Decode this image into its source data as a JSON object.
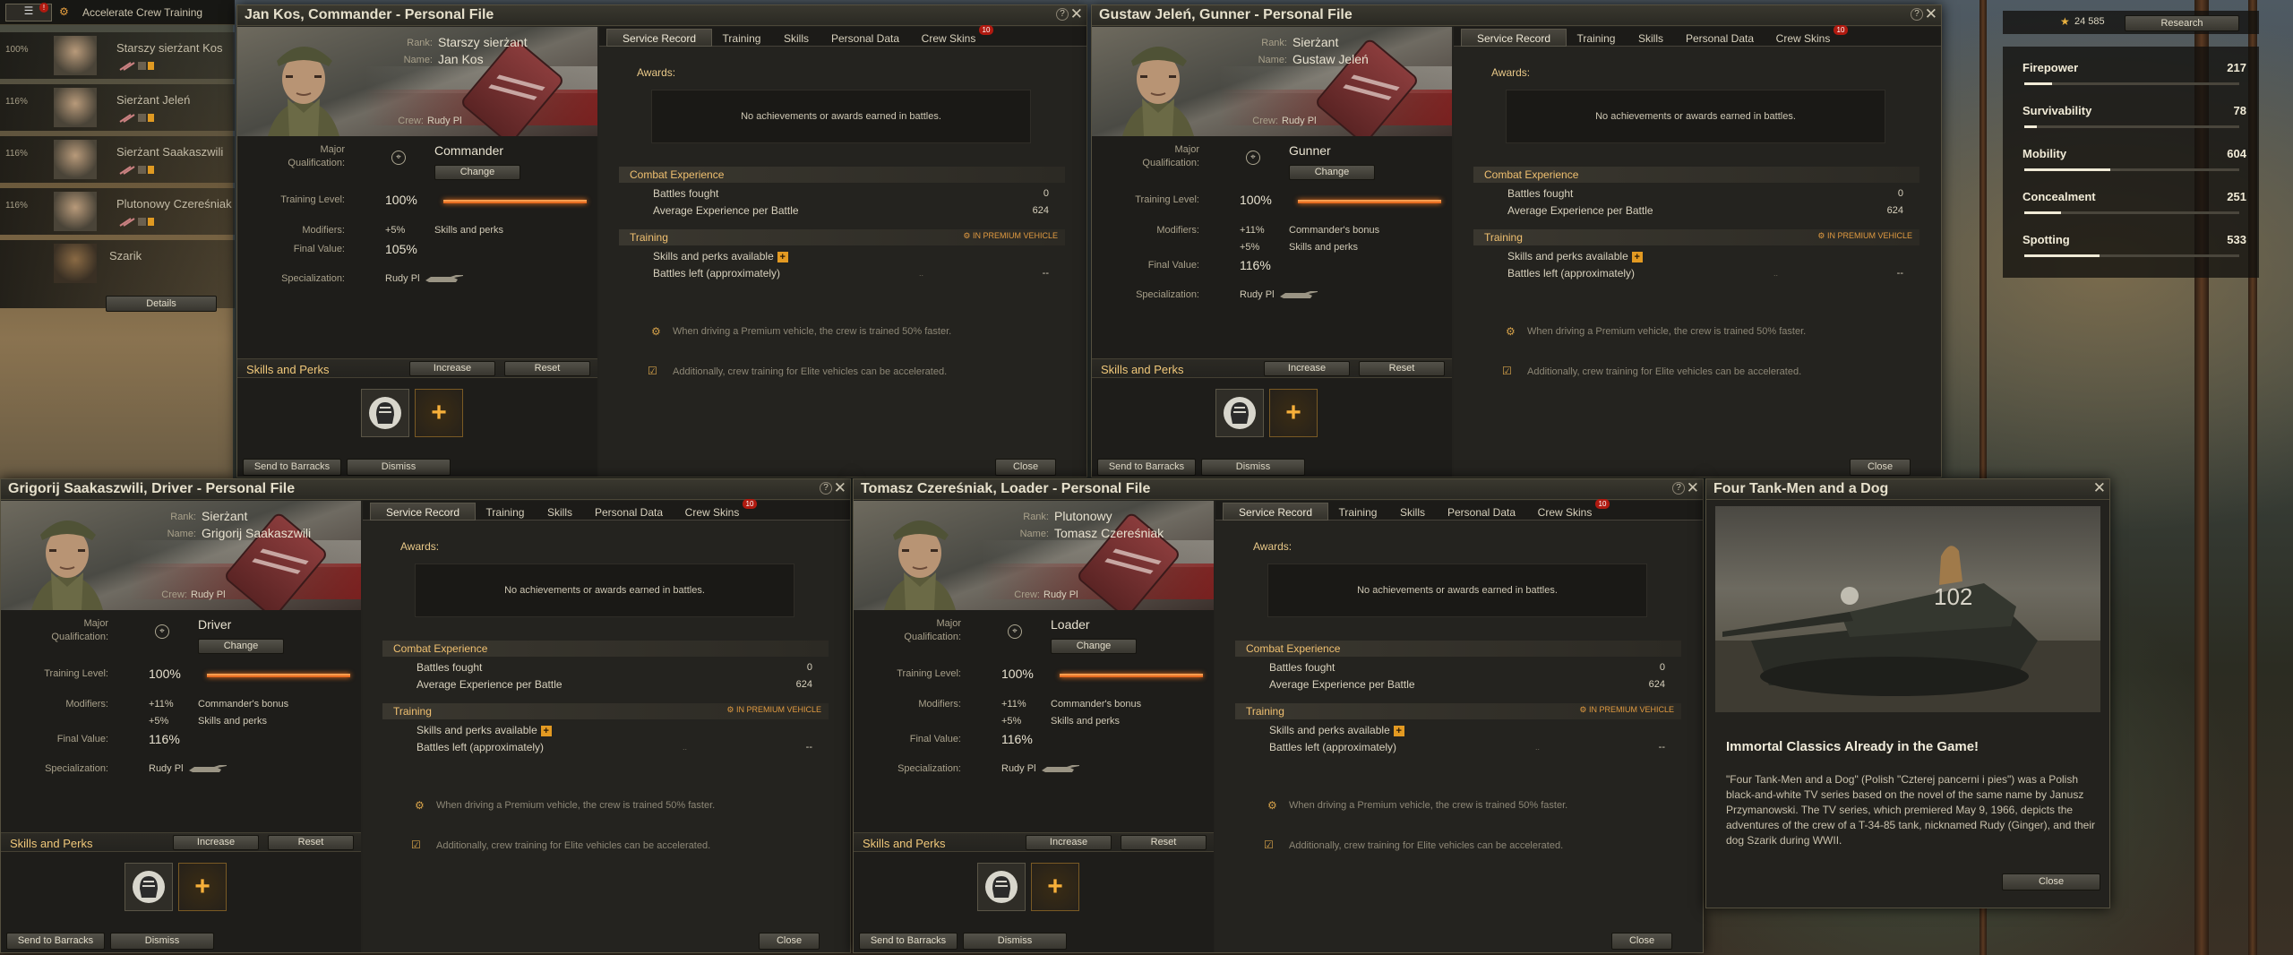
{
  "topbar": {
    "title": "Accelerate Crew Training",
    "badge": "!"
  },
  "crew_list": [
    {
      "pct": "100%",
      "name": "Starszy sierżant Kos"
    },
    {
      "pct": "116%",
      "name": "Sierżant Jeleń"
    },
    {
      "pct": "116%",
      "name": "Sierżant Saakaszwili"
    },
    {
      "pct": "116%",
      "name": "Plutonowy Czereśniak"
    },
    {
      "pct": "",
      "name": "Szarik"
    }
  ],
  "details_button": "Details",
  "resources": {
    "credits": "24 585",
    "research_button": "Research"
  },
  "stats": [
    {
      "label": "Firepower",
      "value": "217",
      "fill": 0.13
    },
    {
      "label": "Survivability",
      "value": "78",
      "fill": 0.06
    },
    {
      "label": "Mobility",
      "value": "604",
      "fill": 0.4
    },
    {
      "label": "Concealment",
      "value": "251",
      "fill": 0.17
    },
    {
      "label": "Spotting",
      "value": "533",
      "fill": 0.35
    }
  ],
  "labels": {
    "rank": "Rank:",
    "name": "Name:",
    "crew": "Crew:",
    "major_qualification_1": "Major",
    "major_qualification_2": "Qualification:",
    "change": "Change",
    "training_level": "Training Level:",
    "modifiers": "Modifiers:",
    "final_value": "Final Value:",
    "specialization": "Specialization:",
    "skills_and_perks": "Skills and Perks",
    "increase": "Increase",
    "reset": "Reset",
    "send_to_barracks": "Send to Barracks",
    "dismiss": "Dismiss",
    "close": "Close",
    "awards": "Awards:",
    "no_awards": "No achievements or awards earned in battles.",
    "combat_experience": "Combat Experience",
    "battles_fought": "Battles fought",
    "avg_exp": "Average Experience per Battle",
    "training": "Training",
    "in_premium": "IN PREMIUM VEHICLE",
    "skills_available": "Skills and perks available",
    "battles_left": "Battles left (approximately)",
    "note_premium": "When driving a Premium vehicle, the crew is trained 50% faster.",
    "note_elite": "Additionally, crew training for Elite vehicles can be accelerated."
  },
  "tabs": [
    "Service Record",
    "Training",
    "Skills",
    "Personal Data",
    "Crew Skins"
  ],
  "tab_badge": "10",
  "windows": [
    {
      "title": "Jan Kos, Commander - Personal File",
      "rank": "Starszy sierżant",
      "name": "Jan Kos",
      "crew": "Rudy Pl",
      "role": "Commander",
      "training_level": "100%",
      "training_fill": 1,
      "mod1": "+5%",
      "mod1_desc": "Skills and perks",
      "mod2": "",
      "mod2_desc": "",
      "final_value": "105%",
      "spec": "Rudy Pl",
      "battles_fought": "0",
      "avg_exp": "624",
      "battles_left": "--"
    },
    {
      "title": "Gustaw Jeleń, Gunner - Personal File",
      "rank": "Sierżant",
      "name": "Gustaw Jeleń",
      "crew": "Rudy Pl",
      "role": "Gunner",
      "training_level": "100%",
      "training_fill": 1,
      "mod1": "+11%",
      "mod1_desc": "Commander's bonus",
      "mod2": "+5%",
      "mod2_desc": "Skills and perks",
      "final_value": "116%",
      "spec": "Rudy Pl",
      "battles_fought": "0",
      "avg_exp": "624",
      "battles_left": "--"
    },
    {
      "title": "Grigorij Saakaszwili, Driver - Personal File",
      "rank": "Sierżant",
      "name": "Grigorij Saakaszwili",
      "crew": "Rudy Pl",
      "role": "Driver",
      "training_level": "100%",
      "training_fill": 1,
      "mod1": "+11%",
      "mod1_desc": "Commander's bonus",
      "mod2": "+5%",
      "mod2_desc": "Skills and perks",
      "final_value": "116%",
      "spec": "Rudy Pl",
      "battles_fought": "0",
      "avg_exp": "624",
      "battles_left": "--"
    },
    {
      "title": "Tomasz Czereśniak, Loader - Personal File",
      "rank": "Plutonowy",
      "name": "Tomasz Czereśniak",
      "crew": "Rudy Pl",
      "role": "Loader",
      "training_level": "100%",
      "training_fill": 1,
      "mod1": "+11%",
      "mod1_desc": "Commander's bonus",
      "mod2": "+5%",
      "mod2_desc": "Skills and perks",
      "final_value": "116%",
      "spec": "Rudy Pl",
      "battles_fought": "0",
      "avg_exp": "624",
      "battles_left": "--"
    }
  ],
  "promo": {
    "title": "Four Tank-Men and a Dog",
    "tank_number": "102",
    "headline": "Immortal Classics Already in the Game!",
    "text": "\"Four Tank-Men and a Dog\" (Polish \"Czterej pancerni i pies\") was a Polish black-and-white TV series based on the novel of the same name by Janusz Przymanowski. The TV series, which premiered May 9, 1966, depicts the adventures of the crew of a T-34-85 tank, nicknamed Rudy (Ginger), and their dog Szarik during WWII.",
    "close": "Close"
  },
  "colors": {
    "accent": "#f0c070",
    "bar": "#e05a10",
    "badge": "#b01a10",
    "plus": "#f7b03a"
  }
}
